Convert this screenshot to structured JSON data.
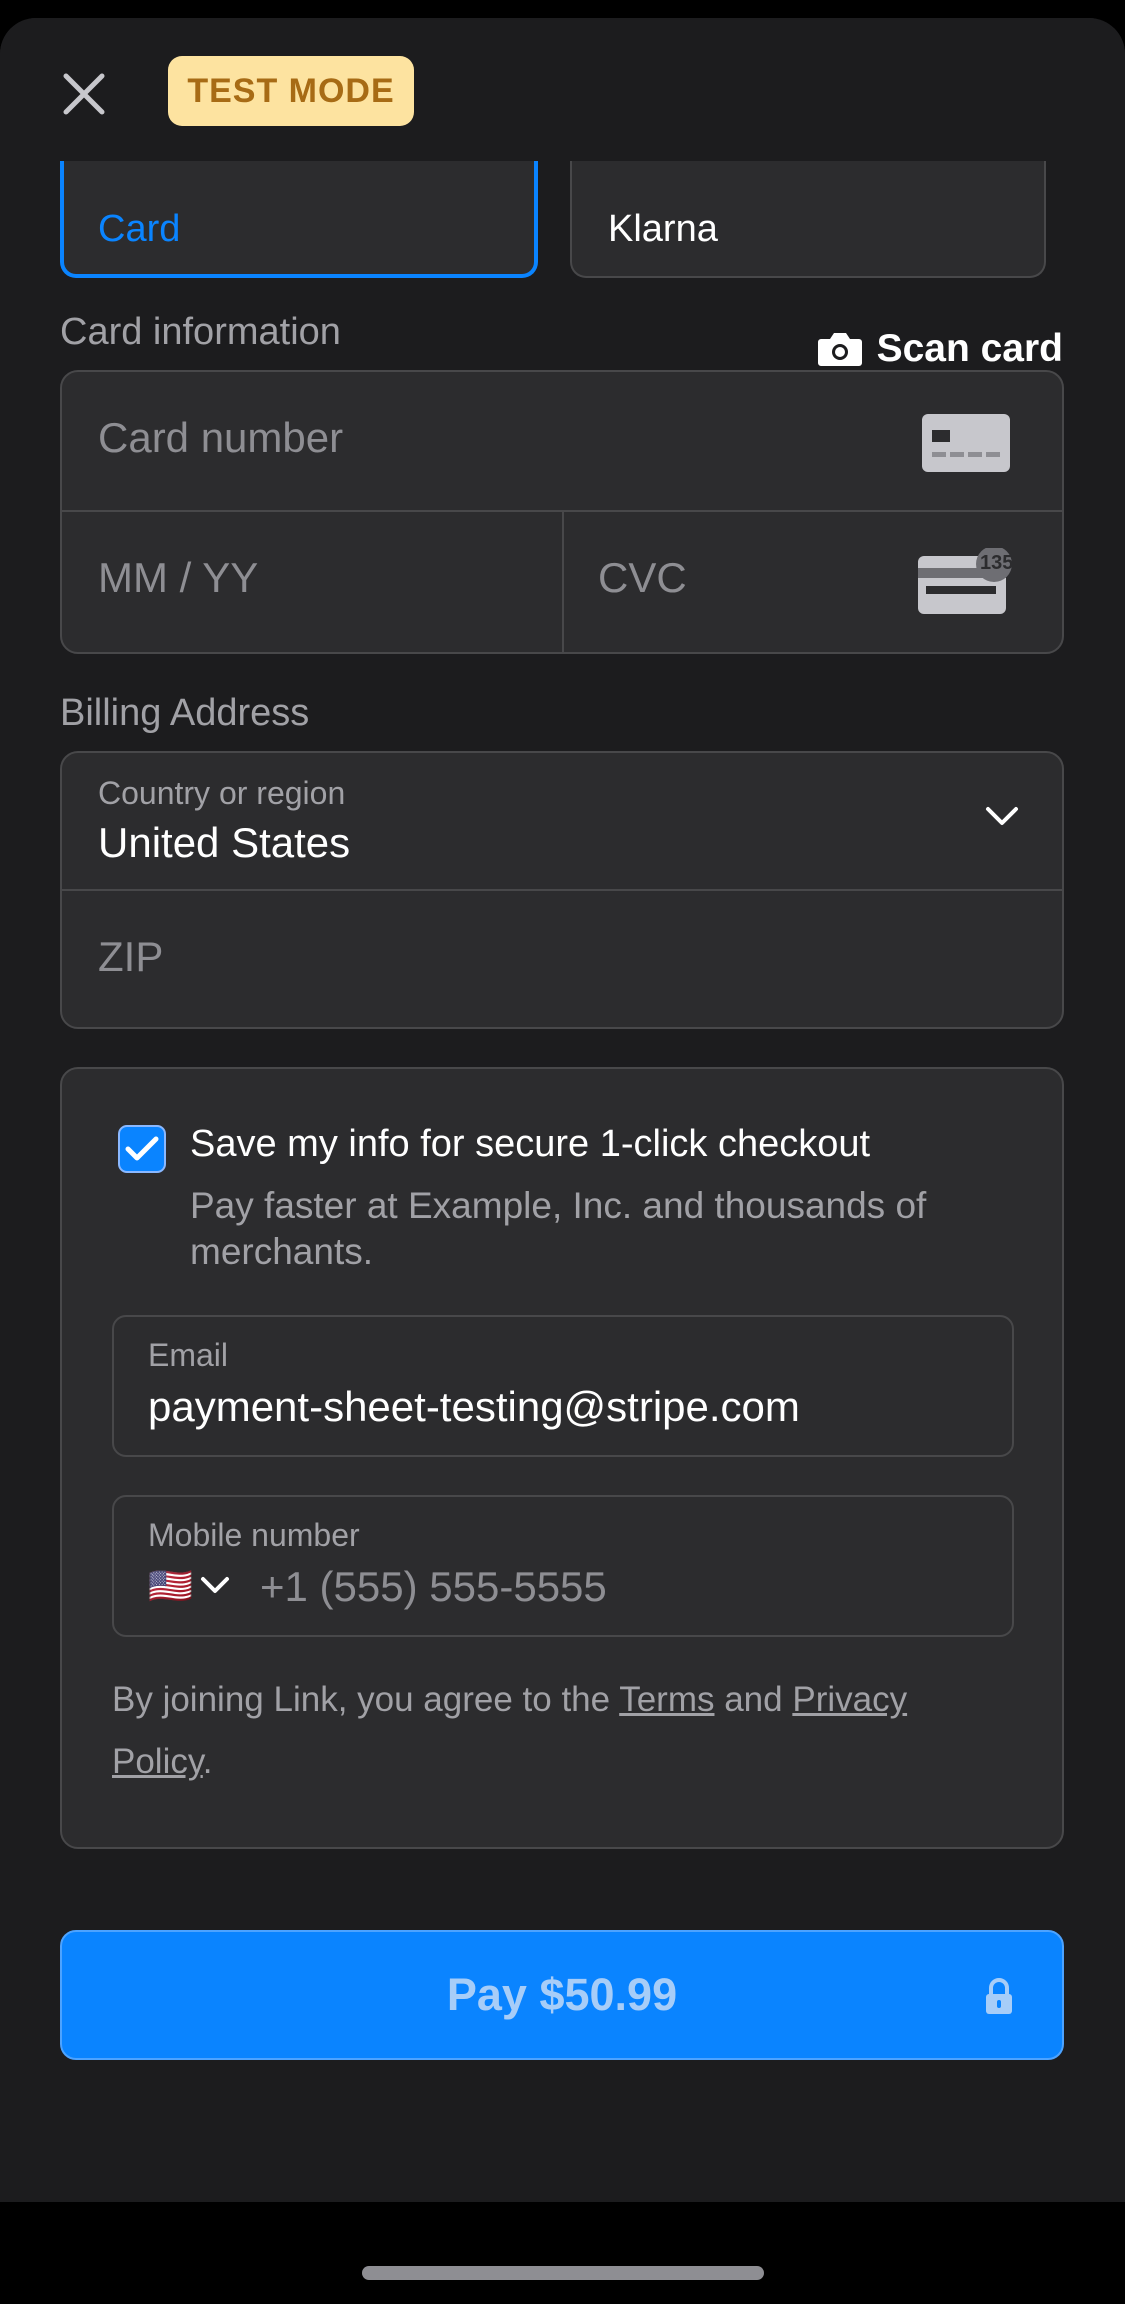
{
  "header": {
    "close_icon": "close-icon",
    "test_mode_label": "TEST MODE"
  },
  "payment_methods": [
    {
      "label": "Card",
      "selected": true,
      "icon": "card-icon"
    },
    {
      "label": "Klarna",
      "selected": false,
      "icon": "klarna-icon"
    }
  ],
  "card_section": {
    "label": "Card information",
    "scan_label": "Scan card",
    "card_number_placeholder": "Card number",
    "expiry_placeholder": "MM / YY",
    "cvc_placeholder": "CVC",
    "cvc_icon_text": "135"
  },
  "billing": {
    "label": "Billing Address",
    "country_label": "Country or region",
    "country_value": "United States",
    "zip_placeholder": "ZIP"
  },
  "link": {
    "checked": true,
    "save_title": "Save my info for secure 1-click checkout",
    "save_subtitle": "Pay faster at Example, Inc. and thousands of merchants.",
    "email_label": "Email",
    "email_value": "payment-sheet-testing@stripe.com",
    "mobile_label": "Mobile number",
    "phone_flag": "🇺🇸",
    "phone_placeholder": "+1 (555) 555-5555",
    "legal_prefix": "By joining Link, you agree to the ",
    "terms_link": "Terms",
    "legal_and": " and ",
    "privacy_link": "Privacy Policy",
    "legal_suffix": "."
  },
  "pay_button": {
    "label": "Pay $50.99",
    "icon": "lock-icon"
  },
  "colors": {
    "accent": "#0a84ff",
    "background": "#1c1c1e",
    "field": "#2c2c2e",
    "badge": "#fde3a0"
  }
}
